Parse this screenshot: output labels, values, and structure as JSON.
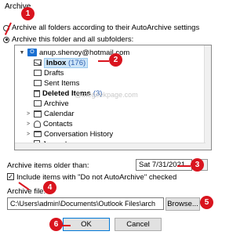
{
  "window": {
    "title": "Archive"
  },
  "options": {
    "all_folders_label": "Archive all folders according to their AutoArchive settings",
    "this_folder_label": "Archive this folder and all subfolders:"
  },
  "tree": {
    "account": "anup.shenoy@hotmail.com",
    "items": [
      {
        "label": "Inbox",
        "count": "(176)"
      },
      {
        "label": "Drafts"
      },
      {
        "label": "Sent Items"
      },
      {
        "label": "Deleted Items",
        "count": "(3)"
      },
      {
        "label": "Archive"
      },
      {
        "label": "Calendar"
      },
      {
        "label": "Contacts"
      },
      {
        "label": "Conversation History"
      },
      {
        "label": "Journal"
      }
    ]
  },
  "watermark": "@thegeekpage.com",
  "older_than": {
    "label": "Archive items older than:",
    "value": "Sat 7/31/2021"
  },
  "include_checkbox": {
    "label": "Include items with \"Do not AutoArchive\" checked",
    "checked": true
  },
  "archive_file": {
    "label": "Archive file:",
    "path": "C:\\Users\\admin\\Documents\\Outlook Files\\arch"
  },
  "buttons": {
    "browse": "Browse...",
    "ok": "OK",
    "cancel": "Cancel"
  },
  "annotations": [
    "1",
    "2",
    "3",
    "4",
    "5",
    "6"
  ],
  "colors": {
    "annotation": "#d9141e",
    "selection": "#cce4f7",
    "count": "#2a5db0"
  }
}
